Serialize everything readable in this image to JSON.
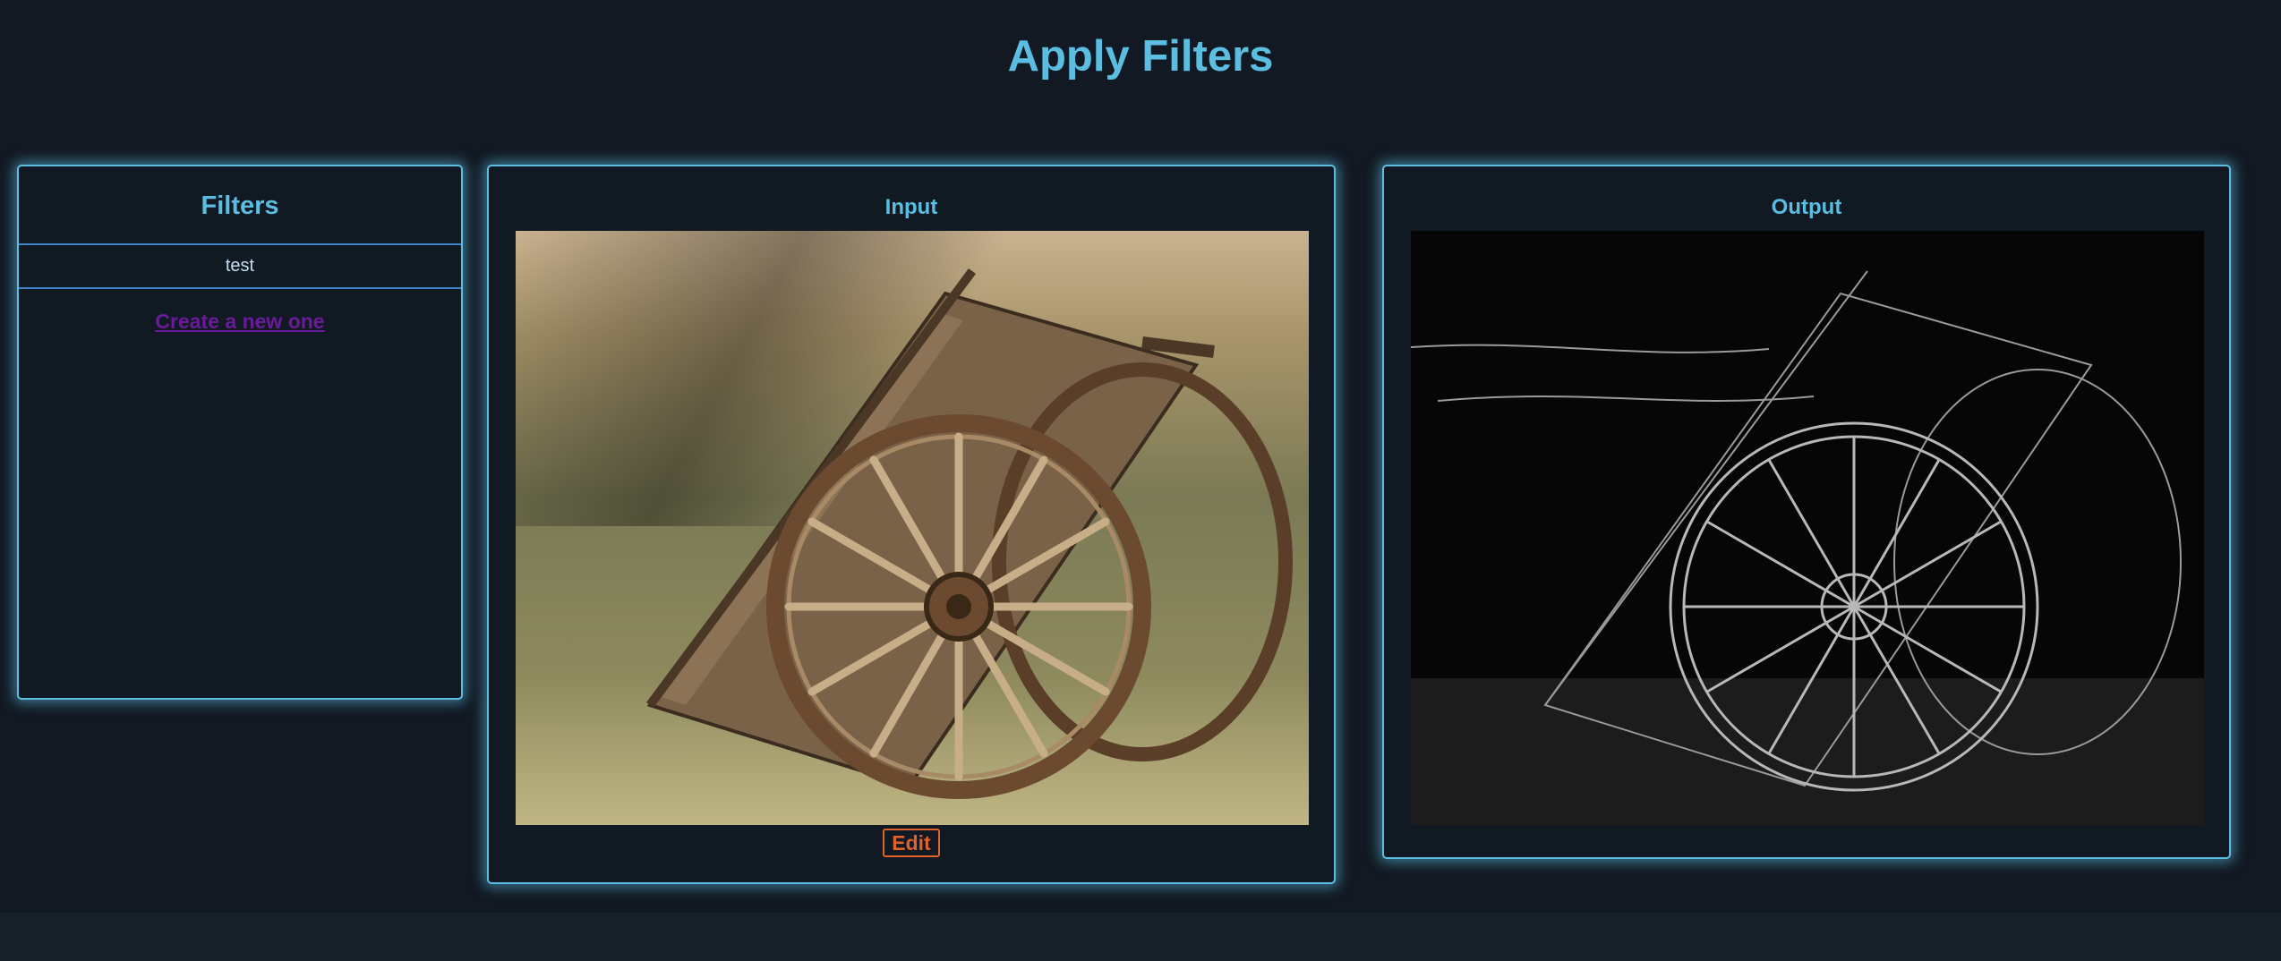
{
  "page": {
    "title": "Apply Filters"
  },
  "filters": {
    "heading": "Filters",
    "items": [
      {
        "label": "test"
      }
    ],
    "create_link": "Create a new one"
  },
  "input": {
    "heading": "Input",
    "edit_label": "Edit"
  },
  "output": {
    "heading": "Output"
  },
  "colors": {
    "accent": "#5bbde0",
    "background": "#121923",
    "edit_button": "#e0612a",
    "link": "#6a1b9a"
  }
}
